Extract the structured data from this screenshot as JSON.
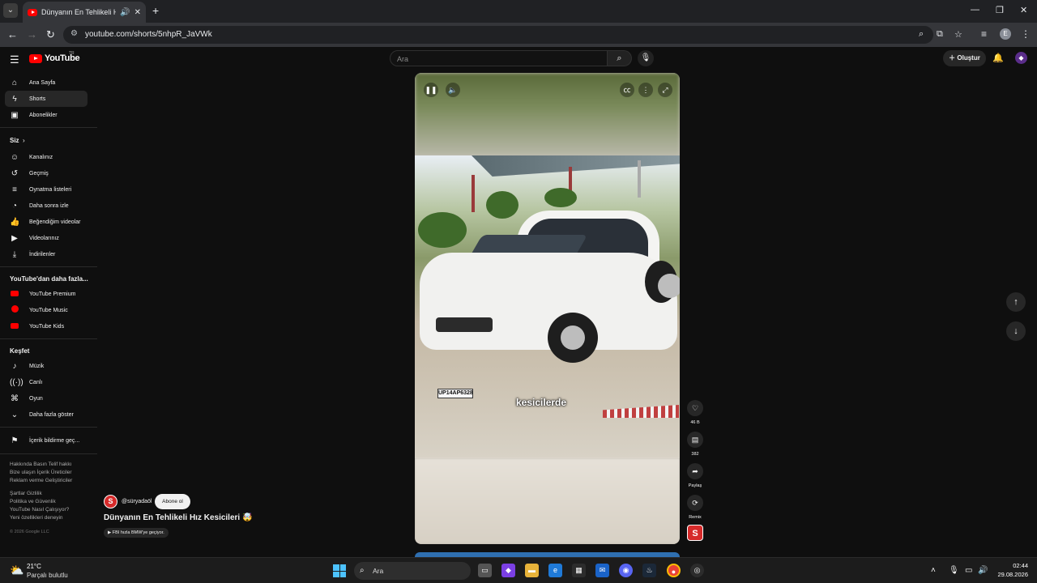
{
  "browser": {
    "tab_title": "Dünyanın En Tehlikeli Hız Ke",
    "url": "youtube.com/shorts/5nhpR_JaVWk",
    "new_tab_label": "+",
    "profile_initial": "E"
  },
  "header": {
    "logo_text": "YouTube",
    "country_code": "TR",
    "search_placeholder": "Ara",
    "create_label": "Oluştur"
  },
  "sidebar": {
    "main": [
      {
        "label": "Ana Sayfa",
        "icon": "home-icon"
      },
      {
        "label": "Shorts",
        "icon": "shorts-icon"
      },
      {
        "label": "Abonelikler",
        "icon": "subscriptions-icon"
      }
    ],
    "you_heading": "Siz",
    "you": [
      {
        "label": "Kanalınız",
        "icon": "channel-icon"
      },
      {
        "label": "Geçmiş",
        "icon": "history-icon"
      },
      {
        "label": "Oynatma listeleri",
        "icon": "playlist-icon"
      },
      {
        "label": "Daha sonra izle",
        "icon": "watch-later-icon"
      },
      {
        "label": "Beğendiğim videolar",
        "icon": "like-icon"
      },
      {
        "label": "Videolarınız",
        "icon": "your-videos-icon"
      },
      {
        "label": "İndirilenler",
        "icon": "download-icon"
      }
    ],
    "more_heading": "YouTube'dan daha fazla...",
    "more": [
      {
        "label": "YouTube Premium"
      },
      {
        "label": "YouTube Music"
      },
      {
        "label": "YouTube Kids"
      }
    ],
    "explore_heading": "Keşfet",
    "explore": [
      {
        "label": "Müzik",
        "icon": "music-icon"
      },
      {
        "label": "Canlı",
        "icon": "live-icon"
      },
      {
        "label": "Oyun",
        "icon": "gaming-icon"
      },
      {
        "label": "Daha fazla göster",
        "icon": "chevron-down-icon"
      }
    ],
    "report_label": "İçerik bildirme geç...",
    "footer": [
      "Hakkında  Basın  Telif hakkı",
      "Bize ulaşın  İçerik Üreticiler",
      "Reklam verme  Geliştiriciler",
      "Şartlar  Gizlilik",
      "Politika ve Güvenlik",
      "YouTube Nasıl Çalışıyor?",
      "Yeni özellikleri deneyin"
    ],
    "copyright": "© 2026 Google LLC"
  },
  "video": {
    "caption": "kesicilerde",
    "plate": "UP14AP6328"
  },
  "actions": {
    "like_count": "46 B",
    "comment_count": "382",
    "share_label": "Paylaş",
    "remix_label": "Remix"
  },
  "short_info": {
    "channel_handle": "@süryadaöl",
    "subscribe_label": "Abone ol",
    "title": "Dünyanın En Tehlikeli Hız Kesicileri 🤯",
    "sound_chip": "▶ FBI hızla BMW'ye geçiyor."
  },
  "taskbar": {
    "temperature": "21°C",
    "weather": "Parçalı bulutlu",
    "search_label": "Ara",
    "time": "02:44",
    "date": "29.08.2026"
  }
}
